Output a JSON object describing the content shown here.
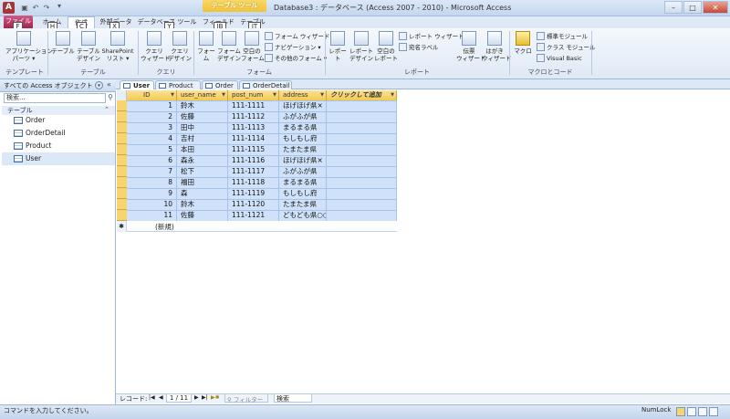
{
  "titlebar": {
    "app_icon": "A",
    "context_tab": "テーブル ツール",
    "title": "Database3 : データベース (Access 2007 - 2010) - Microsoft Access",
    "qat_icons": [
      "save-icon",
      "undo-icon",
      "redo-icon",
      "customize-icon"
    ],
    "minimize": "–",
    "maximize": "□",
    "close": "✕"
  },
  "ribbon_tabs": {
    "file": "ファイル",
    "home": "ホーム",
    "create": "作成",
    "external": "外部データ",
    "dbtools": "データベース ツール",
    "fields": "フィールド",
    "table": "テーブル",
    "keytips": [
      "F",
      "H",
      "C",
      "X",
      "Y",
      "JB",
      "JT"
    ]
  },
  "ribbon": {
    "groups": {
      "templates": "テンプレート",
      "tables": "テーブル",
      "queries": "クエリ",
      "forms": "フォーム",
      "reports": "レポート",
      "macros": "マクロとコード"
    },
    "app_parts": "アプリケーション\nパーツ ▾",
    "table": "テーブル",
    "table_design": "テーブル\nデザイン",
    "sharepoint": "SharePoint\nリスト ▾",
    "query_wizard": "クエリ\nウィザード",
    "query_design": "クエリ\nデザイン",
    "form": "フォーム",
    "form_design": "フォーム\nデザイン",
    "blank_form": "空白の\nフォーム",
    "form_wizard": "フォーム ウィザード",
    "navigation": "ナビゲーション ▾",
    "more_forms": "その他のフォーム ▾",
    "report": "レポート",
    "report_design": "レポート\nデザイン",
    "blank_report": "空白の\nレポート",
    "report_wizard": "レポート ウィザード",
    "labels": "宛名ラベル",
    "slip_wizard": "伝票\nウィザード",
    "postcard_wizard": "はがき\nウィザード",
    "macro": "マクロ",
    "std_module": "標準モジュール",
    "class_module": "クラス モジュール",
    "vba": "Visual Basic"
  },
  "nav": {
    "header": "すべての Access オブジェクト",
    "search_placeholder": "検索...",
    "group": "テーブル",
    "items": [
      "Order",
      "OrderDetail",
      "Product",
      "User"
    ]
  },
  "doc_tabs": [
    "User",
    "Product",
    "Order",
    "OrderDetail"
  ],
  "table": {
    "columns": [
      "ID",
      "user_name",
      "post_num",
      "address",
      "クリックして追加"
    ],
    "rows": [
      [
        "1",
        "鈴木",
        "111-1111",
        "ほげほげ県×"
      ],
      [
        "2",
        "佐藤",
        "111-1112",
        "ふがふが県"
      ],
      [
        "3",
        "田中",
        "111-1113",
        "まるまる県"
      ],
      [
        "4",
        "吉村",
        "111-1114",
        "もしもし府"
      ],
      [
        "5",
        "本田",
        "111-1115",
        "たまたま県"
      ],
      [
        "6",
        "森永",
        "111-1116",
        "ほげほげ県×"
      ],
      [
        "7",
        "松下",
        "111-1117",
        "ふがふが県"
      ],
      [
        "8",
        "福田",
        "111-1118",
        "まるまる県"
      ],
      [
        "9",
        "森",
        "111-1119",
        "もしもし府"
      ],
      [
        "10",
        "鈴木",
        "111-1120",
        "たまたま県"
      ],
      [
        "11",
        "佐藤",
        "111-1121",
        "どもども県○○"
      ]
    ],
    "new_row_marker": "✱",
    "new_row_label": "(新規)"
  },
  "record_nav": {
    "label": "レコード:",
    "first": "|◀",
    "prev": "◀",
    "position": "1 / 11",
    "next": "▶",
    "last": "▶|",
    "new": "▶✱",
    "filter": "フィルターなし",
    "search": "検索"
  },
  "status": {
    "message": "コマンドを入力してください。",
    "numlock": "NumLock"
  }
}
